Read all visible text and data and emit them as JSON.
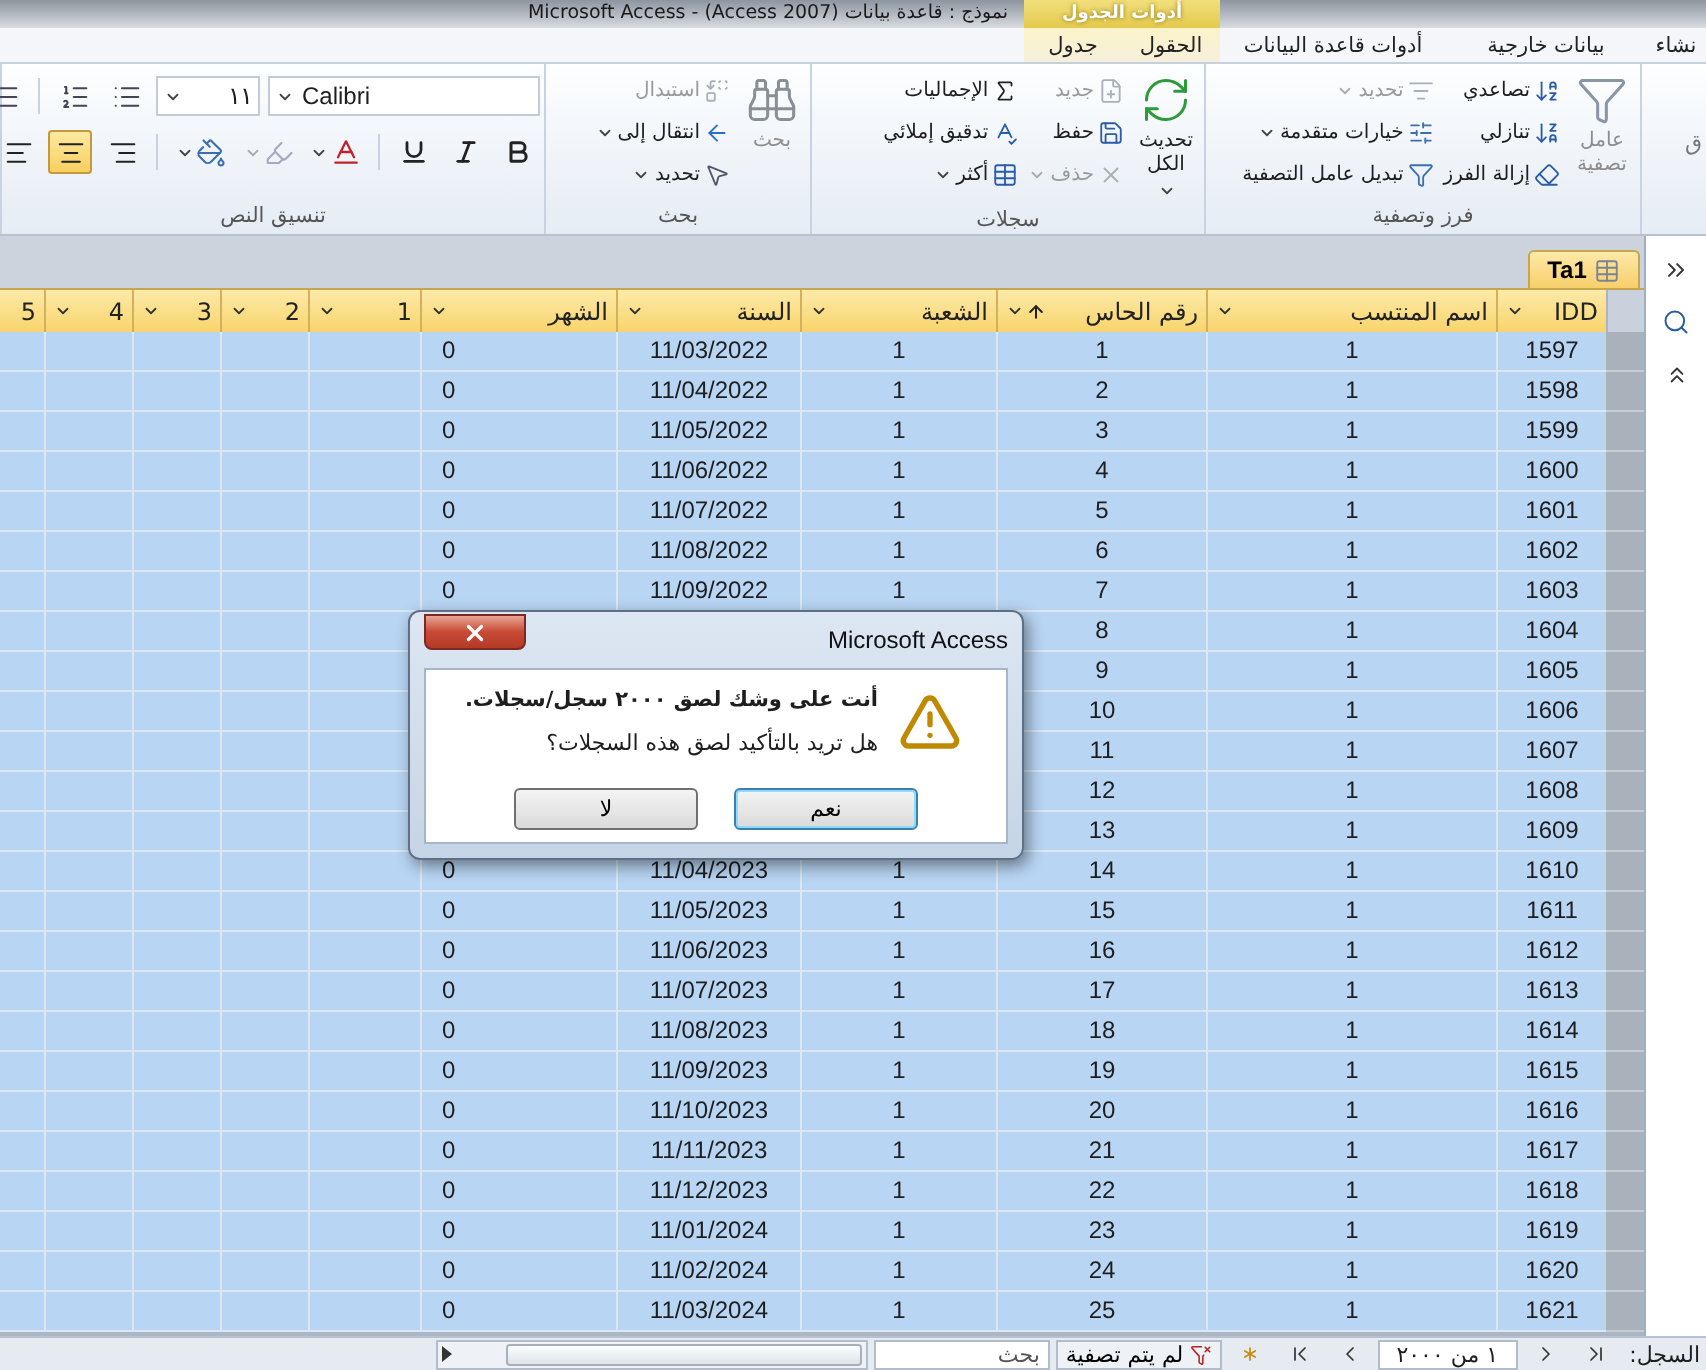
{
  "window": {
    "title": "نموذج : قاعدة بيانات (Access 2007) - Microsoft Access",
    "context_tab": "أدوات الجدول"
  },
  "tabs": [
    {
      "label": "نشاء",
      "selected": false,
      "contextual": false
    },
    {
      "label": "بيانات خارجية",
      "selected": false,
      "contextual": false
    },
    {
      "label": "أدوات قاعدة البيانات",
      "selected": false,
      "contextual": false
    },
    {
      "label": "الحقول",
      "selected": false,
      "contextual": true
    },
    {
      "label": "جدول",
      "selected": false,
      "contextual": true
    }
  ],
  "ribbon": {
    "groups": [
      {
        "kind": "partial",
        "text": "ق"
      },
      {
        "kind": "commands",
        "label": "فرز وتصفية",
        "big": {
          "label": "عامل تصفية",
          "disabled": true,
          "dropdown": false
        },
        "columns": [
          [
            {
              "label": "تصاعدي",
              "disabled": false,
              "dropdown": false
            },
            {
              "label": "تنازلي",
              "disabled": false,
              "dropdown": false
            },
            {
              "label": "إزالة الفرز",
              "disabled": false,
              "dropdown": false
            }
          ],
          [
            {
              "label": "تحديد",
              "disabled": true,
              "dropdown": true
            },
            {
              "label": "خيارات متقدمة",
              "disabled": false,
              "dropdown": true
            },
            {
              "label": "تبديل عامل التصفية",
              "disabled": false,
              "dropdown": false
            }
          ]
        ]
      },
      {
        "kind": "commands",
        "label": "سجلات",
        "big": {
          "label": "تحديث الكل",
          "disabled": false,
          "dropdown": true
        },
        "columns": [
          [
            {
              "label": "جديد",
              "disabled": true,
              "dropdown": false
            },
            {
              "label": "حفظ",
              "disabled": false,
              "dropdown": false
            },
            {
              "label": "حذف",
              "disabled": true,
              "dropdown": true
            }
          ],
          [
            {
              "label": "الإجماليات",
              "disabled": false,
              "dropdown": false
            },
            {
              "label": "تدقيق إملائي",
              "disabled": false,
              "dropdown": false
            },
            {
              "label": "أكثر",
              "disabled": false,
              "dropdown": true
            }
          ]
        ]
      },
      {
        "kind": "commands",
        "label": "بحث",
        "big": {
          "label": "بحث",
          "disabled": true,
          "dropdown": false
        },
        "columns": [
          [
            {
              "label": "استبدال",
              "disabled": true,
              "dropdown": false
            },
            {
              "label": "انتقال إلى",
              "disabled": false,
              "dropdown": true
            },
            {
              "label": "تحديد",
              "disabled": false,
              "dropdown": true
            }
          ]
        ]
      },
      {
        "kind": "text_format",
        "label": "تنسيق النص",
        "font": {
          "value": "Calibri"
        },
        "size": {
          "value": "١١"
        },
        "alignment": [
          {
            "kind": "right",
            "selected": false
          },
          {
            "kind": "center",
            "selected": true
          },
          {
            "kind": "left",
            "selected": false
          }
        ]
      }
    ]
  },
  "document_tab": {
    "label": "Ta1",
    "selected": true
  },
  "table": {
    "columns": [
      {
        "label": "IDD",
        "sorted": false
      },
      {
        "label": "اسم المنتسب",
        "sorted": false
      },
      {
        "label": "رقم الحاس",
        "sorted": true
      },
      {
        "label": "الشعبة",
        "sorted": false
      },
      {
        "label": "السنة",
        "sorted": false
      },
      {
        "label": "الشهر",
        "sorted": false
      },
      {
        "label": "1",
        "sorted": false
      },
      {
        "label": "2",
        "sorted": false
      },
      {
        "label": "3",
        "sorted": false
      },
      {
        "label": "4",
        "sorted": false
      },
      {
        "label": "5",
        "sorted": false
      }
    ],
    "rows": [
      {
        "idd": "1597",
        "member_name": "1",
        "computer_no": "1",
        "section": "1",
        "year": "11/03/2022",
        "month": "0",
        "selected": true
      },
      {
        "idd": "1598",
        "member_name": "1",
        "computer_no": "2",
        "section": "1",
        "year": "11/04/2022",
        "month": "0",
        "selected": true
      },
      {
        "idd": "1599",
        "member_name": "1",
        "computer_no": "3",
        "section": "1",
        "year": "11/05/2022",
        "month": "0",
        "selected": true
      },
      {
        "idd": "1600",
        "member_name": "1",
        "computer_no": "4",
        "section": "1",
        "year": "11/06/2022",
        "month": "0",
        "selected": true
      },
      {
        "idd": "1601",
        "member_name": "1",
        "computer_no": "5",
        "section": "1",
        "year": "11/07/2022",
        "month": "0",
        "selected": true
      },
      {
        "idd": "1602",
        "member_name": "1",
        "computer_no": "6",
        "section": "1",
        "year": "11/08/2022",
        "month": "0",
        "selected": true
      },
      {
        "idd": "1603",
        "member_name": "1",
        "computer_no": "7",
        "section": "1",
        "year": "11/09/2022",
        "month": "0",
        "selected": true
      },
      {
        "idd": "1604",
        "member_name": "1",
        "computer_no": "8",
        "selected": true
      },
      {
        "idd": "1605",
        "member_name": "1",
        "computer_no": "9",
        "selected": true
      },
      {
        "idd": "1606",
        "member_name": "1",
        "computer_no": "10",
        "selected": true
      },
      {
        "idd": "1607",
        "member_name": "1",
        "computer_no": "11",
        "selected": true
      },
      {
        "idd": "1608",
        "member_name": "1",
        "computer_no": "12",
        "selected": true
      },
      {
        "idd": "1609",
        "member_name": "1",
        "computer_no": "13",
        "selected": true
      },
      {
        "idd": "1610",
        "member_name": "1",
        "computer_no": "14",
        "section": "1",
        "year": "11/04/2023",
        "month": "0",
        "selected": true
      },
      {
        "idd": "1611",
        "member_name": "1",
        "computer_no": "15",
        "section": "1",
        "year": "11/05/2023",
        "month": "0",
        "selected": true
      },
      {
        "idd": "1612",
        "member_name": "1",
        "computer_no": "16",
        "section": "1",
        "year": "11/06/2023",
        "month": "0",
        "selected": true
      },
      {
        "idd": "1613",
        "member_name": "1",
        "computer_no": "17",
        "section": "1",
        "year": "11/07/2023",
        "month": "0",
        "selected": true
      },
      {
        "idd": "1614",
        "member_name": "1",
        "computer_no": "18",
        "section": "1",
        "year": "11/08/2023",
        "month": "0",
        "selected": true
      },
      {
        "idd": "1615",
        "member_name": "1",
        "computer_no": "19",
        "section": "1",
        "year": "11/09/2023",
        "month": "0",
        "selected": true
      },
      {
        "idd": "1616",
        "member_name": "1",
        "computer_no": "20",
        "section": "1",
        "year": "11/10/2023",
        "month": "0",
        "selected": true
      },
      {
        "idd": "1617",
        "member_name": "1",
        "computer_no": "21",
        "section": "1",
        "year": "11/11/2023",
        "month": "0",
        "selected": true
      },
      {
        "idd": "1618",
        "member_name": "1",
        "computer_no": "22",
        "section": "1",
        "year": "11/12/2023",
        "month": "0",
        "selected": true
      },
      {
        "idd": "1619",
        "member_name": "1",
        "computer_no": "23",
        "section": "1",
        "year": "11/01/2024",
        "month": "0",
        "selected": true
      },
      {
        "idd": "1620",
        "member_name": "1",
        "computer_no": "24",
        "section": "1",
        "year": "11/02/2024",
        "month": "0",
        "selected": true
      },
      {
        "idd": "1621",
        "member_name": "1",
        "computer_no": "25",
        "section": "1",
        "year": "11/03/2024",
        "month": "0",
        "selected": true
      }
    ]
  },
  "status_bar": {
    "record_label": "السجل:",
    "record_position": "١ من ٢٠٠٠",
    "filter_state": "لم يتم تصفية",
    "search": {
      "placeholder": "بحث"
    }
  },
  "dialog": {
    "title": "Microsoft Access",
    "message": "أنت على وشك لصق ٢٠٠٠ سجل/سجلات.",
    "question": "هل تريد بالتأكيد لصق هذه السجلات؟",
    "buttons": [
      {
        "label": "نعم",
        "default": true
      },
      {
        "label": "لا",
        "default": false
      }
    ]
  }
}
